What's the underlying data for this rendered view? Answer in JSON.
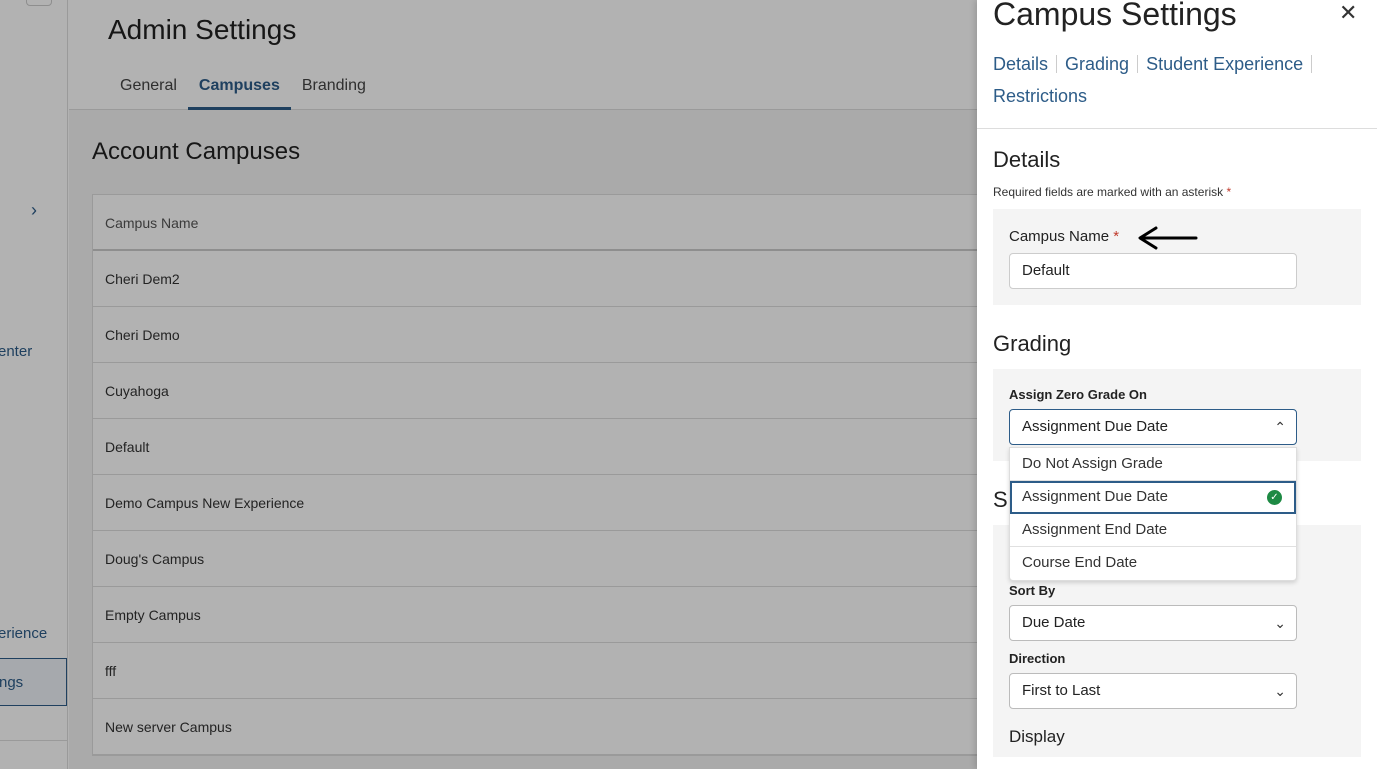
{
  "page": {
    "title": "Admin Settings",
    "tabs": [
      "General",
      "Campuses",
      "Branding"
    ],
    "active_tab": "Campuses",
    "section_title": "Account Campuses",
    "table": {
      "header": "Campus Name",
      "rows": [
        "Cheri Dem2",
        "Cheri Demo",
        "Cuyahoga",
        "Default",
        "Demo Campus New Experience",
        "Doug's Campus",
        "Empty Campus",
        "fff",
        "New server Campus"
      ]
    }
  },
  "left_nav": {
    "chevron": "›",
    "partial_items": [
      "enter",
      "erience"
    ],
    "active_partial": "ngs"
  },
  "panel": {
    "title": "Campus Settings",
    "close": "✕",
    "nav": [
      "Details",
      "Grading",
      "Student Experience",
      "Restrictions"
    ],
    "details": {
      "heading": "Details",
      "required_note": "Required fields are marked with an asterisk",
      "asterisk": "*",
      "campus_name_label": "Campus Name",
      "campus_name_value": "Default"
    },
    "grading": {
      "heading": "Grading",
      "assign_zero_label": "Assign Zero Grade On",
      "assign_zero_value": "Assignment Due Date",
      "options": [
        "Do Not Assign Grade",
        "Assignment Due Date",
        "Assignment End Date",
        "Course End Date"
      ],
      "selected_option": "Assignment Due Date"
    },
    "student_experience": {
      "heading_partial": "S",
      "sort_by_label": "Sort By",
      "sort_by_value": "Due Date",
      "direction_label": "Direction",
      "direction_value": "First to Last",
      "display_label": "Display"
    },
    "icons": {
      "close": "close-icon",
      "chevron_up": "chevron-up-icon",
      "chevron_down": "chevron-down-icon",
      "check": "check-circle-icon",
      "arrow": "arrow-left-annotation"
    }
  },
  "colors": {
    "accent": "#2d5c88",
    "required": "#c0392b",
    "success": "#1e8a44"
  }
}
